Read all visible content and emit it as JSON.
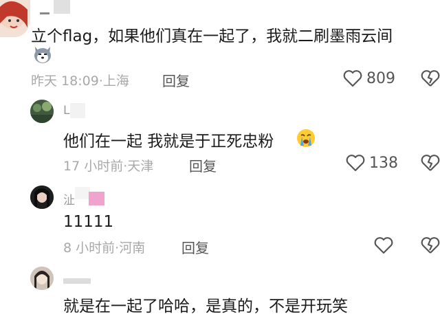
{
  "comments": [
    {
      "content": "立个flag，如果他们真在一起了，我就二刷墨雨云间",
      "time": "昨天 18:09",
      "location": "上海",
      "reply_label": "回复",
      "likes": "809"
    },
    {
      "username": "L",
      "content": "他们在一起 我就是于正死忠粉",
      "time": "17 小时前",
      "location": "天津",
      "reply_label": "回复",
      "likes": "138"
    },
    {
      "username": "沚",
      "content": "11111",
      "time": "8 小时前",
      "location": "河南",
      "reply_label": "回复",
      "likes": ""
    },
    {
      "content": "就是在一起了哈哈，是真的，不是开玩笑"
    }
  ],
  "separator": "·",
  "icons": [
    "heart-icon",
    "broken-heart-icon",
    "husky-emoji",
    "crying-emoji"
  ],
  "colors": {
    "meta": "#a8a8a8",
    "pink_badge": "#f0a3cc"
  }
}
